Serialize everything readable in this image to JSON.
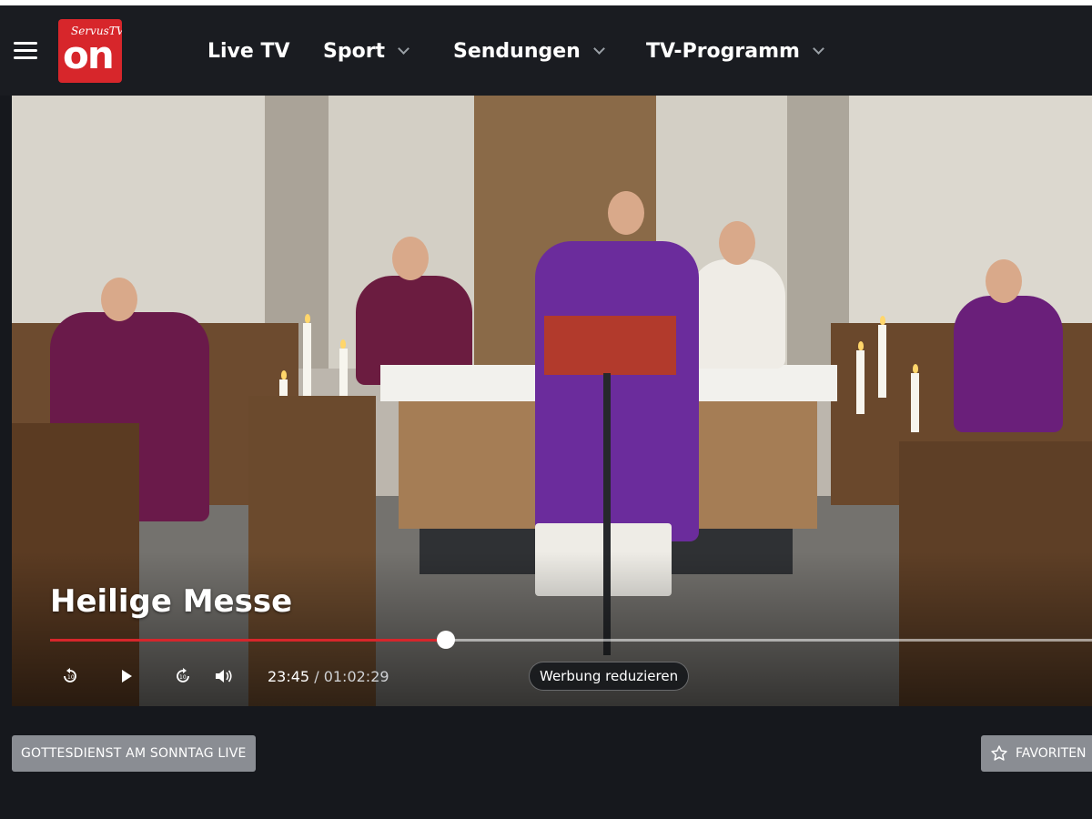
{
  "header": {
    "logo_top": "ServusTV",
    "logo_main": "on",
    "nav": [
      {
        "label": "Live TV"
      },
      {
        "label": "Sport"
      },
      {
        "label": "Sendungen"
      },
      {
        "label": "TV-Programm"
      }
    ]
  },
  "player": {
    "title": "Heilige Messe",
    "current_time": "23:45",
    "separator": "/",
    "duration": "01:02:29",
    "progress_fraction": 0.38,
    "ad_button": "Werbung reduzieren",
    "controls": [
      "rewind-10",
      "play",
      "forward-10",
      "volume"
    ]
  },
  "below": {
    "category_tag": "GOTTESDIENST AM SONNTAG LIVE",
    "favorite_label": "FAVORITEN"
  },
  "colors": {
    "accent": "#d7262b",
    "background": "#16181d",
    "button_gray": "#8a8d93"
  }
}
